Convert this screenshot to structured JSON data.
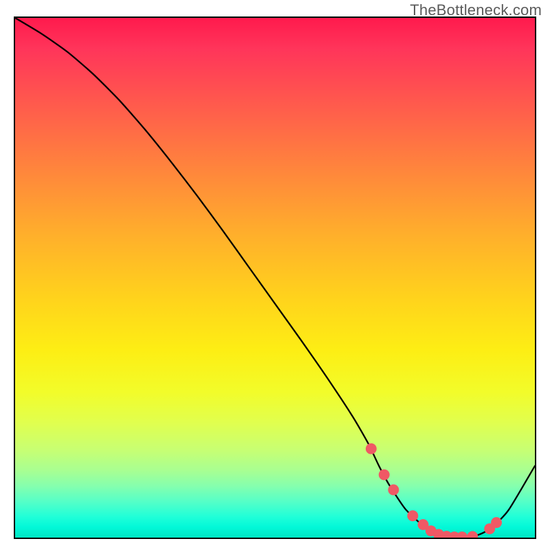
{
  "watermark": "TheBottleneck.com",
  "colors": {
    "frame_border": "#000000",
    "curve": "#000000",
    "dot_fill": "#ef5965",
    "dot_stroke": "#c74855"
  },
  "chart_data": {
    "type": "line",
    "title": "",
    "xlabel": "",
    "ylabel": "",
    "xlim": [
      0,
      100
    ],
    "ylim": [
      0,
      100
    ],
    "series": [
      {
        "name": "bottleneck-curve",
        "x": [
          0,
          5,
          10,
          15,
          20,
          25,
          30,
          35,
          40,
          45,
          50,
          55,
          60,
          65,
          68,
          70,
          72,
          75,
          78,
          80,
          82,
          85,
          88,
          90,
          92,
          95,
          100
        ],
        "y": [
          100,
          97,
          93.5,
          89.2,
          84.2,
          78.5,
          72.3,
          65.8,
          59,
          52,
          45,
          38,
          30.8,
          23.2,
          18,
          13.8,
          10.1,
          5.6,
          2.7,
          1.3,
          0.5,
          0.12,
          0.2,
          0.9,
          2.2,
          5.4,
          13.8
        ]
      }
    ],
    "dots": {
      "name": "highlight-points",
      "x": [
        68.5,
        71,
        72.8,
        76.5,
        78.5,
        80,
        81.5,
        83,
        84.5,
        86,
        88,
        91.3,
        92.6
      ],
      "y": [
        17.1,
        12.1,
        9.2,
        4.2,
        2.5,
        1.3,
        0.6,
        0.25,
        0.12,
        0.12,
        0.2,
        1.7,
        2.9
      ]
    }
  }
}
